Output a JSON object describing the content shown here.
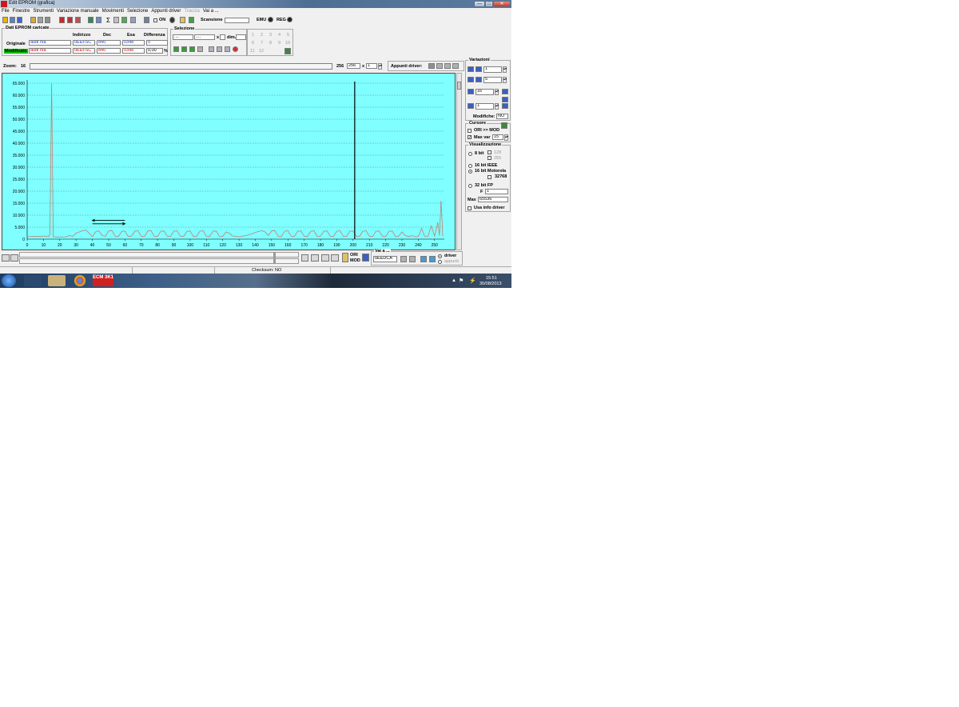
{
  "window": {
    "title": "Edit EPROM (grafica)",
    "minimize_label": "—",
    "maximize_label": "□",
    "close_label": "✕"
  },
  "menu": [
    "File",
    "Finestre",
    "Strumenti",
    "Variazione manuale",
    "Movimenti",
    "Selezione",
    "Appunti driver",
    "Traccia",
    "Vai a ..."
  ],
  "menu_disabled": [
    "Traccia"
  ],
  "toolbar": {
    "on_label": "ON",
    "scansione_label": "Scansione",
    "emu_label": "EMU",
    "reg_label": "REG"
  },
  "dati": {
    "title": "Dati EPROM caricate",
    "headers": [
      "Indirizzo",
      "Dec",
      "Esa",
      "Differenza"
    ],
    "originale": {
      "label": "Originale",
      "name": "audi rsa",
      "indirizzo": "0EEFSC",
      "dec": "840",
      "esa": "0348",
      "diff": "0"
    },
    "modificato": {
      "label": "Modificato",
      "name": "audi rsa",
      "indirizzo": "0EEFSC",
      "dec": "840",
      "esa": "0348",
      "diff": "0,00",
      "unit": "%"
    }
  },
  "selezione": {
    "title": "Selezione",
    "x_label": "x",
    "dim_label": "dim.",
    "field1": "....",
    "field2": "....",
    "numbers": [
      "1",
      "2",
      "3",
      "4",
      "5",
      "6",
      "7",
      "8",
      "9",
      "10",
      "11",
      "12"
    ]
  },
  "zoom": {
    "label": "Zoom:",
    "value": "16",
    "width": "256",
    "width_field": "256",
    "x_label": "x",
    "multiplier": "1"
  },
  "appunti": {
    "label": "Appunti driver:"
  },
  "variazioni": {
    "title": "Variazioni",
    "v1": "1",
    "v2": "5",
    "v3": "16",
    "v4": "1",
    "modifiche_label": "Modifiche:",
    "modifiche_value": "NO"
  },
  "cursore": {
    "title": "Cursore",
    "ori_mod": "ORI >> MOD",
    "max_var_label": "Max var",
    "max_var_value": "15"
  },
  "visualizzazione": {
    "title": "Visualizzazione",
    "bit8": "8 bit",
    "v128": "128",
    "v255": "255",
    "ieee": "16 bit IEEE",
    "motorola": "16 bit Motorola",
    "v32768": "32768",
    "fp": "32 bit FP",
    "f_label": "F",
    "f_value": "1",
    "max_label": "Max",
    "max_value": "65536",
    "usa_info": "Usa info driver"
  },
  "nav": {
    "ori": "ORI",
    "mod": "MOD",
    "vai_title": "Vai a ...",
    "vai_value": "0EEDCA",
    "driver": "driver",
    "appunti": "appunti"
  },
  "status": {
    "checksum": "Checksum: NO"
  },
  "taskbar": {
    "time": "15:51",
    "date": "30/08/2013",
    "app_label": "ECM 3K1"
  },
  "colors": {
    "plot_bg": "#7fffff",
    "line": "#c08070",
    "cursor": "#000000",
    "modificato_bg": "#00c000"
  },
  "chart_data": {
    "type": "line",
    "xlim": [
      0,
      256
    ],
    "ylim": [
      0,
      65000
    ],
    "xticks": [
      0,
      10,
      20,
      30,
      40,
      50,
      60,
      70,
      80,
      90,
      100,
      110,
      120,
      130,
      140,
      150,
      160,
      170,
      180,
      190,
      200,
      210,
      220,
      230,
      240,
      250
    ],
    "yticks": [
      0,
      5000,
      10000,
      15000,
      20000,
      25000,
      30000,
      35000,
      40000,
      45000,
      50000,
      55000,
      60000,
      65000
    ],
    "ytick_labels": [
      "0",
      "5.000",
      "10.000",
      "15.000",
      "20.000",
      "25.000",
      "30.000",
      "35.000",
      "40.000",
      "45.000",
      "50.000",
      "55.000",
      "60.000",
      "65.000"
    ],
    "grid": true,
    "cursor_x": 201,
    "series": [
      {
        "x": [
          0,
          4,
          8,
          10,
          12,
          13,
          14,
          15,
          16,
          18,
          20,
          24,
          26,
          28,
          30,
          32,
          34,
          36,
          38,
          40,
          42,
          44,
          46,
          48,
          50,
          52,
          54,
          56,
          58,
          60,
          62,
          64,
          66,
          68,
          70,
          72,
          74,
          76,
          78,
          80,
          82,
          84,
          86,
          88,
          90,
          92,
          94,
          96,
          98,
          100,
          102,
          104,
          106,
          108,
          110,
          112,
          114,
          116,
          118,
          120,
          122,
          124,
          126,
          128,
          130,
          132,
          134,
          136,
          138,
          140,
          142,
          144,
          146,
          148,
          150,
          152,
          154,
          156,
          158,
          160,
          162,
          164,
          166,
          168,
          170,
          172,
          174,
          176,
          178,
          180,
          182,
          184,
          186,
          188,
          190,
          192,
          194,
          196,
          198,
          200,
          202,
          204,
          206,
          208,
          210,
          212,
          214,
          216,
          218,
          220,
          222,
          224,
          226,
          228,
          230,
          232,
          234,
          235,
          236,
          238,
          240,
          241,
          242,
          244,
          246,
          248,
          250,
          251,
          252,
          253,
          254,
          255
        ],
        "values": [
          1000,
          1200,
          1100,
          1300,
          1200,
          1000,
          2000,
          65000,
          1000,
          900,
          800,
          1000,
          1500,
          1200,
          2500,
          3000,
          3500,
          3800,
          2500,
          1000,
          3000,
          3500,
          1500,
          1200,
          3400,
          3600,
          1200,
          1100,
          3200,
          3400,
          1100,
          1200,
          3300,
          3500,
          1200,
          1100,
          3400,
          3500,
          1200,
          1100,
          3300,
          3400,
          1200,
          1100,
          3300,
          3500,
          1200,
          1100,
          3200,
          3400,
          1100,
          1200,
          3300,
          3500,
          1200,
          1100,
          3300,
          3400,
          1200,
          1100,
          3000,
          2500,
          1300,
          1200,
          1000,
          1200,
          1500,
          1800,
          2200,
          2800,
          3200,
          3500,
          3000,
          1500,
          3400,
          3600,
          1200,
          1100,
          3300,
          3500,
          1200,
          1100,
          3300,
          3400,
          1200,
          1100,
          3200,
          3500,
          1100,
          1200,
          3300,
          3400,
          1200,
          1100,
          3300,
          3500,
          1200,
          1100,
          3300,
          3400,
          1100,
          1200,
          3300,
          3500,
          1200,
          1100,
          3300,
          3400,
          1200,
          1100,
          3200,
          3400,
          1100,
          1200,
          3000,
          1500,
          1100,
          1200,
          1500,
          1000,
          1100,
          2500,
          4500,
          1200,
          1200,
          5500,
          1200,
          4000,
          7000,
          1500,
          16000,
          1200
        ]
      }
    ]
  }
}
